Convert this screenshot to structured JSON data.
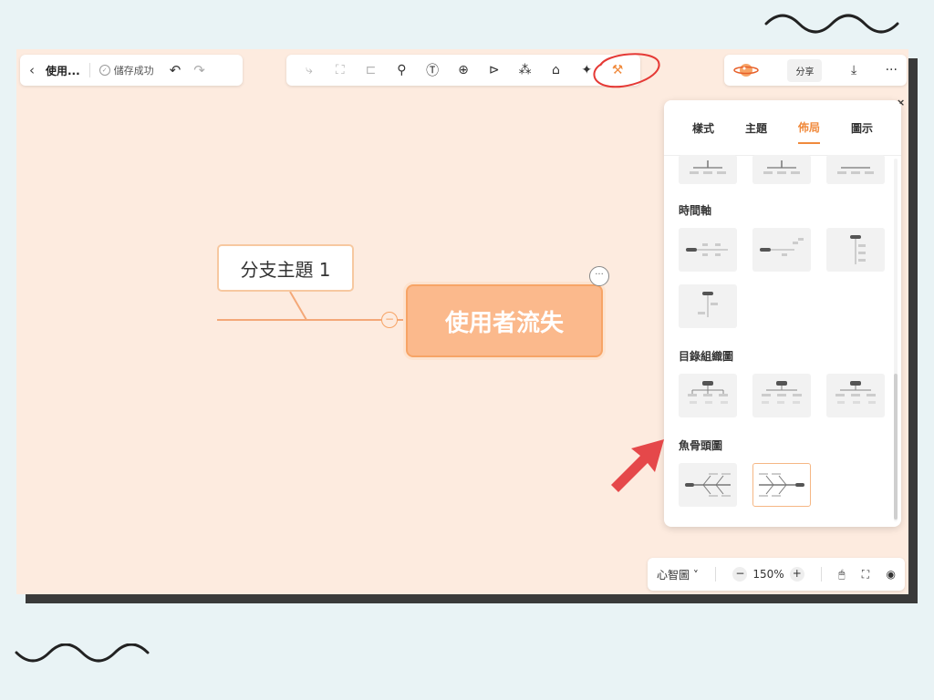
{
  "header": {
    "back_icon": "chevron-left-icon",
    "doc_title": "使用...",
    "save_status": "儲存成功",
    "undo_icon": "undo-icon",
    "redo_icon": "redo-icon"
  },
  "toolbar": {
    "items": [
      {
        "name": "add-subtopic-icon",
        "glyph": "⤷",
        "state": "dim"
      },
      {
        "name": "add-topic-icon",
        "glyph": "⛶",
        "state": "dim"
      },
      {
        "name": "add-sibling-icon",
        "glyph": "⊏",
        "state": "dim"
      },
      {
        "name": "format-painter-icon",
        "glyph": "⚲",
        "state": "normal"
      },
      {
        "name": "text-icon",
        "glyph": "Ⓣ",
        "state": "normal"
      },
      {
        "name": "insert-icon",
        "glyph": "⊕",
        "state": "normal"
      },
      {
        "name": "summary-icon",
        "glyph": "⊳",
        "state": "normal"
      },
      {
        "name": "relation-icon",
        "glyph": "⁂",
        "state": "normal"
      },
      {
        "name": "presentation-icon",
        "glyph": "⌂",
        "state": "normal"
      },
      {
        "name": "ai-sparkle-icon",
        "glyph": "✦",
        "state": "normal"
      },
      {
        "name": "layout-style-icon",
        "glyph": "⚒",
        "state": "orange"
      }
    ]
  },
  "topright": {
    "avatar_icon": "planet-icon",
    "share_label": "分享",
    "export_icon": "download-icon",
    "more_icon": "more-icon",
    "more_glyph": "···"
  },
  "canvas": {
    "branch_topic": "分支主題 1",
    "central_topic": "使用者流失",
    "more_glyph": "···",
    "collapse_glyph": "−"
  },
  "panel": {
    "close_glyph": "×",
    "tabs": [
      {
        "label": "樣式",
        "active": false
      },
      {
        "label": "主題",
        "active": false
      },
      {
        "label": "佈局",
        "active": true
      },
      {
        "label": "圖示",
        "active": false
      }
    ],
    "sections": [
      {
        "title": "時間軸",
        "options": [
          "timeline-horizontal-1",
          "timeline-horizontal-2",
          "timeline-vertical-1",
          "timeline-vertical-2"
        ]
      },
      {
        "title": "目錄組織圖",
        "options": [
          "org-tree-1",
          "org-tree-2",
          "org-tree-3"
        ]
      },
      {
        "title": "魚骨頭圖",
        "options": [
          "fishbone-left",
          "fishbone-right"
        ]
      }
    ],
    "selected_option": "fishbone-right"
  },
  "bottombar": {
    "view_mode": "心智圖",
    "zoom_minus": "−",
    "zoom_level": "150%",
    "zoom_plus": "+",
    "mouse_icon": "mouse-icon",
    "fit_icon": "fit-screen-icon",
    "preview_icon": "eye-icon"
  },
  "colors": {
    "accent": "#f08a3c",
    "central_fill": "#fbb98c",
    "canvas_bg": "#fdebdf",
    "annotation_red": "#e53935"
  }
}
